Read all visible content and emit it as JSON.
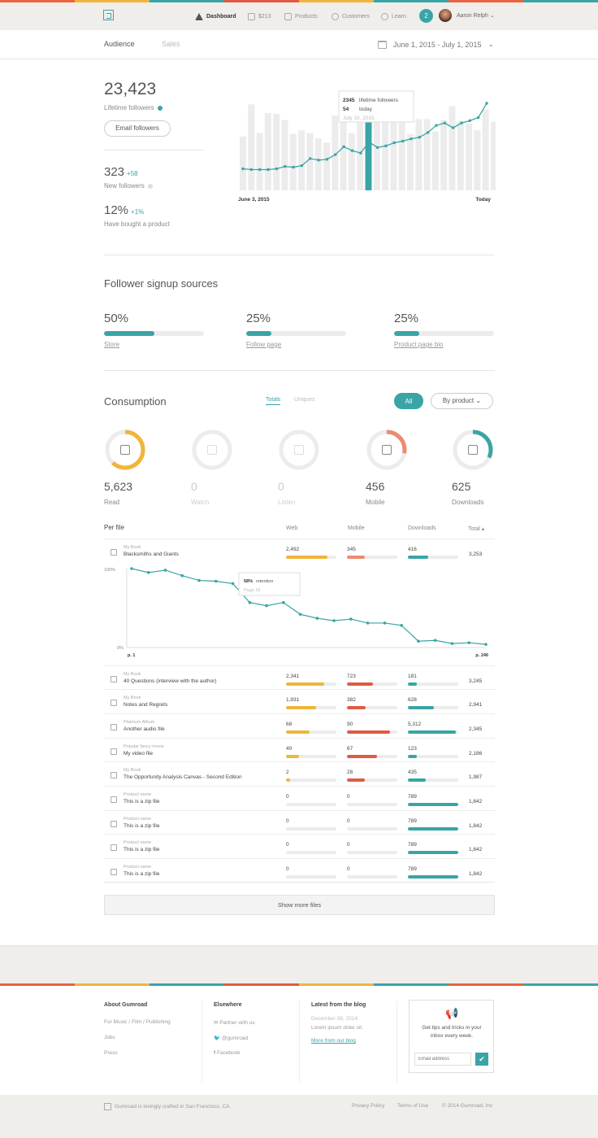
{
  "colors": {
    "teal": "#3aa4a6",
    "yellow": "#f0b53a",
    "coral": "#ec8a73",
    "red": "#e05a44",
    "gray": "#ececec"
  },
  "nav": {
    "items": [
      {
        "label": "Dashboard",
        "icon": "dashboard-icon",
        "active": true
      },
      {
        "label": "$213",
        "icon": "tag-icon",
        "active": false
      },
      {
        "label": "Products",
        "icon": "products-icon",
        "active": false
      },
      {
        "label": "Customers",
        "icon": "customers-icon",
        "active": false
      },
      {
        "label": "Learn",
        "icon": "compass-icon",
        "active": false
      }
    ],
    "notifications": "2",
    "user": "Aaron Relph"
  },
  "tabs": {
    "audience": "Audience",
    "sales": "Sales"
  },
  "daterange": "June 1, 2015 - July 1, 2015",
  "stats": {
    "lifetime": {
      "value": "23,423",
      "label": "Lifetime followers"
    },
    "email_button": "Email followers",
    "new": {
      "value": "323",
      "delta": "+58",
      "label": "New followers"
    },
    "bought": {
      "value": "12%",
      "delta": "+1%",
      "label": "Have bought a product"
    }
  },
  "chart_data": {
    "type": "bar",
    "x_start": "June 3, 2015",
    "x_end": "Today",
    "values": [
      62,
      99,
      66,
      89,
      88,
      81,
      65,
      69,
      66,
      60,
      55,
      86,
      92,
      66,
      80,
      98,
      103,
      78,
      85,
      78,
      65,
      82,
      82,
      68,
      81,
      97,
      80,
      77,
      69,
      93,
      79
    ],
    "line": [
      17,
      16,
      16,
      16,
      17,
      20,
      19,
      21,
      30,
      28,
      29,
      35,
      45,
      40,
      37,
      51,
      44,
      46,
      50,
      52,
      55,
      57,
      63,
      72,
      75,
      69,
      75,
      78,
      82,
      100
    ],
    "highlight_index": 15,
    "tooltip": {
      "followers": "2345",
      "followers_label": "lifetime followers",
      "today": "54",
      "today_label": "today",
      "date": "July 10, 2015"
    }
  },
  "signup": {
    "title": "Follower signup sources",
    "sources": [
      {
        "pct": "50%",
        "value": 0.5,
        "label": "Store"
      },
      {
        "pct": "25%",
        "value": 0.25,
        "label": "Follow page"
      },
      {
        "pct": "25%",
        "value": 0.25,
        "label": "Product page bio"
      }
    ]
  },
  "consumption": {
    "title": "Consumption",
    "tab_totals": "Totals",
    "tab_uniques": "Uniques",
    "btn_all": "All",
    "btn_product": "By product",
    "items": [
      {
        "value": "5,623",
        "label": "Read",
        "fraction": 0.62,
        "color": "#f0b53a",
        "active": true,
        "icon": "book-icon"
      },
      {
        "value": "0",
        "label": "Watch",
        "fraction": 0,
        "color": "#ececec",
        "active": false,
        "icon": "video-icon"
      },
      {
        "value": "0",
        "label": "Listen",
        "fraction": 0,
        "color": "#ececec",
        "active": false,
        "icon": "audio-icon"
      },
      {
        "value": "456",
        "label": "Mobile",
        "fraction": 0.28,
        "color": "#ec8a73",
        "active": true,
        "icon": "mobile-icon"
      },
      {
        "value": "625",
        "label": "Downloads",
        "fraction": 0.32,
        "color": "#3aa4a6",
        "active": true,
        "icon": "download-icon"
      }
    ]
  },
  "perfile": {
    "title": "Per file",
    "col_web": "Web",
    "col_mobile": "Mobile",
    "col_downloads": "Downloads",
    "col_total": "Total",
    "rows": [
      {
        "cat": "My Book",
        "name": "Blacksmiths and Giants",
        "web": "2,492",
        "wf": 0.83,
        "mobile": "345",
        "mf": 0.35,
        "dl": "416",
        "df": 0.4,
        "total": "3,253",
        "mcolor": "#ec8a73"
      },
      {
        "cat": "My Book",
        "name": "40 Questions (interview with the author)",
        "web": "2,341",
        "wf": 0.75,
        "mobile": "723",
        "mf": 0.52,
        "dl": "181",
        "df": 0.17,
        "total": "3,245",
        "mcolor": "#e05a44"
      },
      {
        "cat": "My Book",
        "name": "Notes and Regrets",
        "web": "1,931",
        "wf": 0.6,
        "mobile": "382",
        "mf": 0.37,
        "dl": "628",
        "df": 0.52,
        "total": "2,941",
        "mcolor": "#e05a44"
      },
      {
        "cat": "Platinum Album",
        "name": "Another audio file",
        "web": "68",
        "wf": 0.47,
        "mobile": "90",
        "mf": 0.85,
        "dl": "5,312",
        "df": 0.95,
        "total": "2,345",
        "mcolor": "#e05a44"
      },
      {
        "cat": "Popular fancy movie",
        "name": "My video file",
        "web": "40",
        "wf": 0.25,
        "mobile": "67",
        "mf": 0.59,
        "dl": "123",
        "df": 0.17,
        "total": "2,186",
        "mcolor": "#e05a44"
      },
      {
        "cat": "My Book",
        "name": "The Opportunity Analysis Canvas - Second Edition",
        "web": "2",
        "wf": 0.08,
        "mobile": "28",
        "mf": 0.35,
        "dl": "435",
        "df": 0.35,
        "total": "1,987",
        "mcolor": "#e05a44"
      },
      {
        "cat": "Product name",
        "name": "This is a zip file",
        "web": "0",
        "wf": 0,
        "mobile": "0",
        "mf": 0,
        "dl": "789",
        "df": 1,
        "total": "1,842",
        "mcolor": "#e05a44"
      },
      {
        "cat": "Product name",
        "name": "This is a zip file",
        "web": "0",
        "wf": 0,
        "mobile": "0",
        "mf": 0,
        "dl": "789",
        "df": 1,
        "total": "1,842",
        "mcolor": "#e05a44"
      },
      {
        "cat": "Product name",
        "name": "This is a zip file",
        "web": "0",
        "wf": 0,
        "mobile": "0",
        "mf": 0,
        "dl": "789",
        "df": 1,
        "total": "1,842",
        "mcolor": "#e05a44"
      },
      {
        "cat": "Product name",
        "name": "This is a zip file",
        "web": "0",
        "wf": 0,
        "mobile": "0",
        "mf": 0,
        "dl": "789",
        "df": 1,
        "total": "1,842",
        "mcolor": "#e05a44"
      }
    ],
    "retention": {
      "y_top": "100%",
      "y_bottom": "0%",
      "x_start": "p. 1",
      "x_end": "p. 246",
      "values": [
        100,
        95,
        98,
        91,
        85,
        84,
        81,
        57,
        53,
        57,
        42,
        37,
        34,
        36,
        31,
        31,
        28,
        8,
        9,
        5,
        6,
        4
      ],
      "tooltip": {
        "value": "58%",
        "label": "retention",
        "sub": "Page 16"
      }
    },
    "more": "Show more files"
  },
  "footer": {
    "about": {
      "title": "About Gumroad",
      "l1a": "For Music",
      "l1b": "Film",
      "l1c": "Publishing",
      "sep": "/",
      "l2": "Jobs",
      "l3": "Press"
    },
    "elsewhere": {
      "title": "Elsewhere",
      "l1": "Partner with us",
      "l2": "@gumroad",
      "l3": "Facebook"
    },
    "blog": {
      "title": "Latest from the blog",
      "date": "December 08, 2014",
      "text": "Lorem ipsum dolar sit.",
      "more": "More from our blog"
    },
    "news": {
      "text": "Get tips and tricks in your inbox every week.",
      "placeholder": "Email address"
    },
    "bottom": {
      "crafted": "Gumroad is lovingly crafted in San Francisco, CA.",
      "privacy": "Privacy Policy",
      "terms": "Terms of Use",
      "copyright": "© 2014 Gumroad, Inc"
    }
  }
}
